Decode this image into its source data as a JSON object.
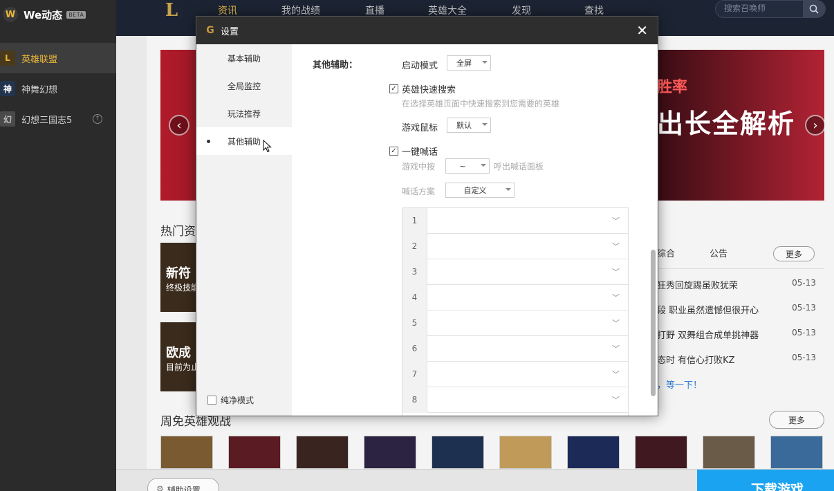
{
  "sidebar": {
    "brand_title": "We动态",
    "brand_badge": "BETA",
    "games": [
      {
        "label": "英雄联盟"
      },
      {
        "label": "神舞幻想"
      },
      {
        "label": "幻想三国志5"
      }
    ]
  },
  "topnav": {
    "items": [
      "资讯",
      "我的战绩",
      "直播",
      "英雄大全",
      "发现",
      "查找"
    ],
    "active_index": 0,
    "search_placeholder": "搜索召唤师"
  },
  "main": {
    "banner": {
      "subtitle": "胜率",
      "title": "出长全解析"
    },
    "hot_title": "热门资",
    "hot_cards": [
      {
        "title": "新符",
        "subtitle": "终极技能"
      },
      {
        "title": "欧成",
        "subtitle": "目前为止"
      }
    ],
    "news_tabs": [
      "综合",
      "公告"
    ],
    "news_more": "更多",
    "news": [
      {
        "text": "狂秀回旋踢虽败犹荣",
        "date": "05-13"
      },
      {
        "text": "段 职业虽然遗憾但很开心",
        "date": "05-13"
      },
      {
        "text": "打野 双舞组合成单挑神器",
        "date": "05-13"
      },
      {
        "text": "态时 有信心打败KZ",
        "date": "05-13"
      }
    ],
    "news_wait": "，等一下！",
    "free_title": "周免英雄观战",
    "free_more": "更多",
    "hero_colors": [
      "#7a5a30",
      "#5a1c22",
      "#3a2420",
      "#2c2242",
      "#1e3050",
      "#c09a58",
      "#1c2a58",
      "#401820",
      "#6a5a48",
      "#3a6a9a"
    ]
  },
  "bottom": {
    "assist_settings": "辅助设置",
    "download": "下载游戏"
  },
  "dialog": {
    "title": "设置",
    "tabs": [
      "基本辅助",
      "全局监控",
      "玩法推荐",
      "其他辅助"
    ],
    "active_tab": 3,
    "pure_mode": "纯净模式",
    "section_label": "其他辅助：",
    "launch_mode_label": "启动模式",
    "launch_mode_value": "全屏",
    "quick_search_label": "英雄快速搜索",
    "quick_search_checked": true,
    "quick_search_hint": "在选择英雄页面中快速搜索到您需要的英雄",
    "mouse_label": "游戏鼠标",
    "mouse_value": "默认",
    "shout_label": "一键喊话",
    "shout_checked": true,
    "in_game_press": "游戏中按",
    "hotkey_value": "~",
    "call_panel": "呼出喊话面板",
    "scheme_label": "喊话方案",
    "scheme_value": "自定义",
    "phrases": [
      "1",
      "2",
      "3",
      "4",
      "5",
      "6",
      "7",
      "8"
    ]
  }
}
